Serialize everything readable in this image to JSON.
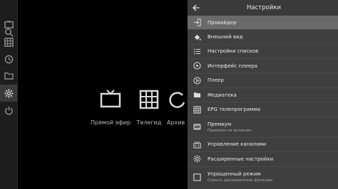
{
  "rail": {
    "items": [
      {
        "icon": "search-icon"
      },
      {
        "icon": "tv-icon"
      },
      {
        "icon": "grid-icon"
      },
      {
        "icon": "history-icon"
      },
      {
        "icon": "folder-icon"
      },
      {
        "icon": "settings-icon",
        "active": true
      },
      {
        "icon": "power-icon"
      }
    ]
  },
  "main": {
    "tiles": [
      {
        "label": "Прямой эфир",
        "icon": "tv-icon"
      },
      {
        "label": "Телегид",
        "icon": "grid-icon"
      },
      {
        "label": "Архив",
        "icon": "history-icon"
      }
    ]
  },
  "settings": {
    "title": "Настройки",
    "items": [
      {
        "label": "Провайдер",
        "icon": "login-icon",
        "selected": true
      },
      {
        "label": "Внешний вид",
        "icon": "paint-bucket-icon"
      },
      {
        "label": "Настройки списков",
        "icon": "list-icon"
      },
      {
        "label": "Интерфейс плеера",
        "icon": "play-circle-icon"
      },
      {
        "label": "Плеер",
        "icon": "play-icon"
      },
      {
        "label": "Медиатека",
        "icon": "folder-icon"
      },
      {
        "label": "EPG телепрограмма",
        "icon": "grid-icon"
      },
      {
        "label": "Премиум",
        "sublabel": "Премиум не включен",
        "icon": "premium-icon"
      },
      {
        "label": "Управление каналами",
        "icon": "channels-icon"
      },
      {
        "label": "Расширенные настройки",
        "icon": "gear-icon"
      },
      {
        "label": "Упрощенный режим",
        "sublabel": "Скрыть расширенные функции",
        "icon": "checkbox-icon"
      }
    ]
  },
  "colors": {
    "background": "#000000",
    "panel": "#3f3f3f",
    "selected": "#6a6a6a",
    "rail": "#1d1d1d"
  }
}
